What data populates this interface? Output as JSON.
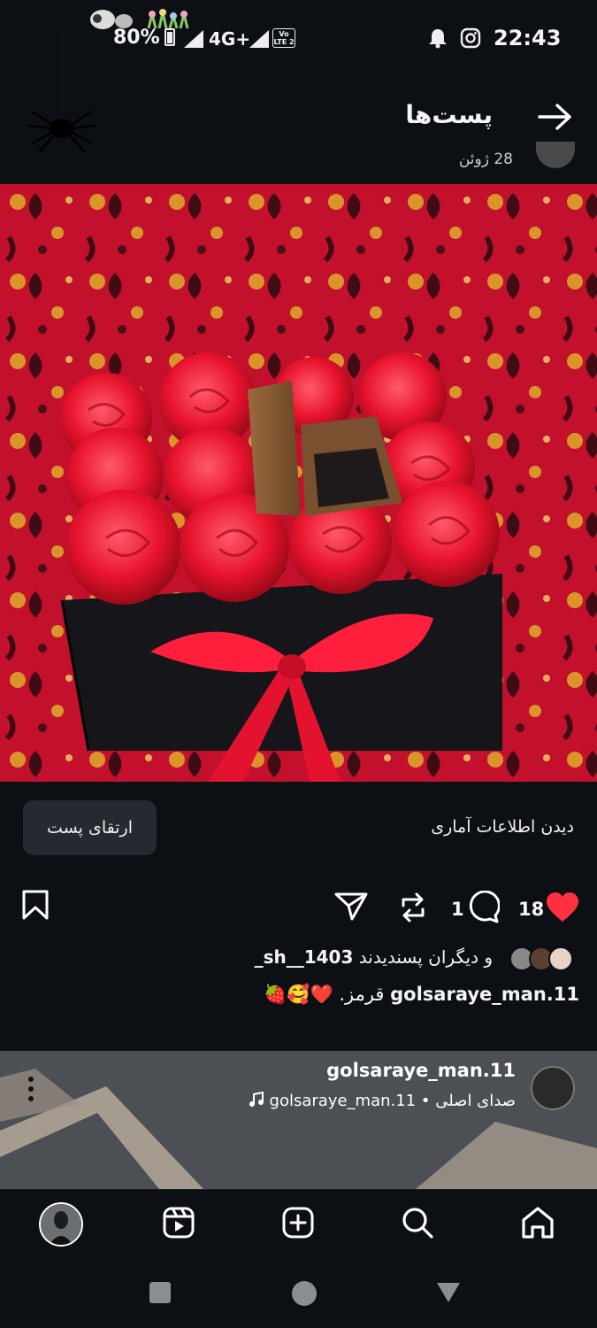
{
  "status_bar": {
    "battery": "80%",
    "network": "4G+",
    "volte_line1": "Vo",
    "volte_line2": "LTE 2",
    "time": "22:43"
  },
  "header": {
    "title": "پست‌ها",
    "back_icon": "arrow-right-icon",
    "peek_date": "28 ژوئن"
  },
  "post": {
    "boost_label": "ارتقای پست",
    "insights_label": "دیدن اطلاعات آماری",
    "likes_count": "18",
    "comments_count": "1",
    "liked_by_user": "sh__1403_",
    "liked_by_suffix": "و دیگران پسندیدند",
    "caption_user": "golsaraye_man.11",
    "caption_text": "قرمز.",
    "caption_emoji": "❤️🥰🍓",
    "accent_heart": "#ff3040"
  },
  "next_post": {
    "author": "golsaraye_man.11",
    "audio_label": "صدای اصلی",
    "audio_user": "golsaraye_man.11"
  },
  "bottom_nav": {
    "items": [
      "home-icon",
      "search-icon",
      "create-icon",
      "reels-icon",
      "profile-avatar"
    ]
  },
  "system_nav": [
    "back-icon",
    "home-icon",
    "recents-icon"
  ]
}
